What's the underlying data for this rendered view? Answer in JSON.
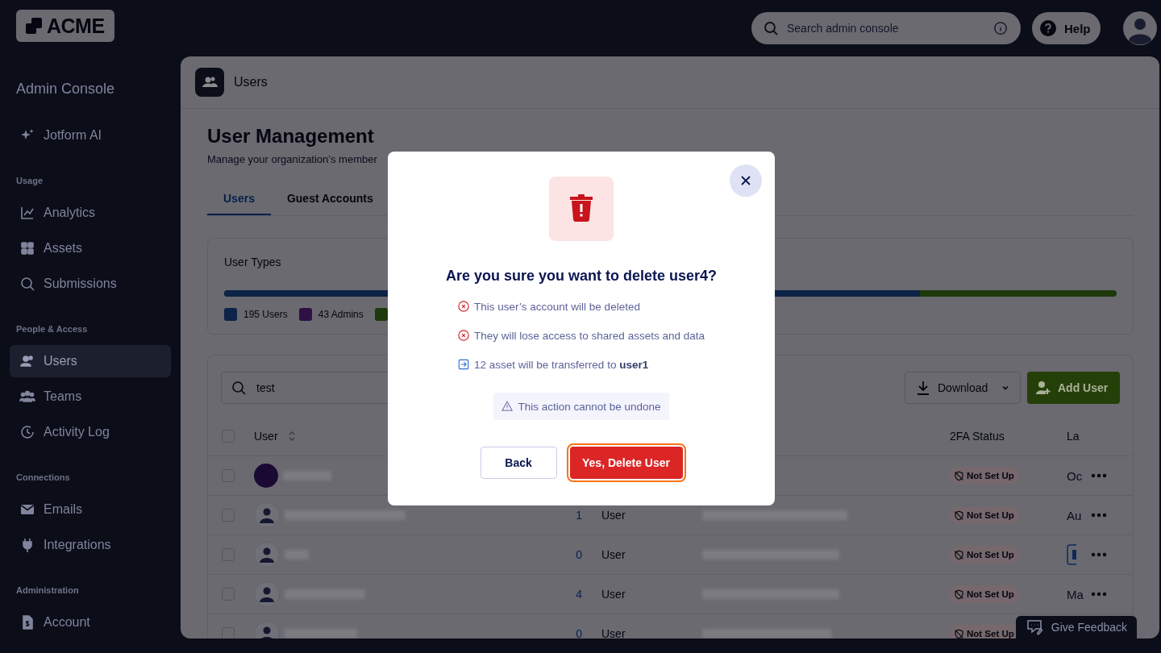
{
  "logo": {
    "text": "ACME"
  },
  "topbar": {
    "search": {
      "placeholder": "Search admin console"
    },
    "help": "Help"
  },
  "sidebar": {
    "title": "Admin Console",
    "sections": [
      {
        "items": [
          {
            "label": "Jotform AI",
            "selected": false
          }
        ]
      },
      {
        "heading": "Usage",
        "items": [
          {
            "label": "Analytics",
            "selected": false
          },
          {
            "label": "Assets",
            "selected": false
          },
          {
            "label": "Submissions",
            "selected": false
          }
        ]
      },
      {
        "heading": "People & Access",
        "items": [
          {
            "label": "Users",
            "selected": true
          },
          {
            "label": "Teams",
            "selected": false
          },
          {
            "label": "Activity Log",
            "selected": false
          }
        ]
      },
      {
        "heading": "Connections",
        "items": [
          {
            "label": "Emails",
            "selected": false
          },
          {
            "label": "Integrations",
            "selected": false
          }
        ]
      },
      {
        "heading": "Administration",
        "items": [
          {
            "label": "Account",
            "selected": false
          }
        ]
      }
    ]
  },
  "page": {
    "header": "Users",
    "title": "User Management",
    "subtitle": "Manage your organization’s member",
    "tabs": [
      {
        "label": "Users",
        "selected": true
      },
      {
        "label": "Guest Accounts",
        "selected": false
      }
    ],
    "user_types": {
      "title": "User Types",
      "level": 0.78,
      "legend": [
        {
          "label": "195 Users",
          "color": "#0d2347"
        },
        {
          "label": "43 Admins",
          "color": "#2e1044"
        },
        {
          "color": "#1e3a0c"
        }
      ]
    },
    "table": {
      "search": {
        "value": "test"
      },
      "download": "Download",
      "add_user": "Add User",
      "select_all": {
        "checked": false
      },
      "columns": {
        "user": "User",
        "twofa": "2FA Status",
        "last": "La"
      },
      "rows": [
        {
          "checked": false,
          "photo": true,
          "twofa": "Not Set Up",
          "last": "Oc"
        },
        {
          "checked": false,
          "photo": false,
          "count": "1",
          "role": "User",
          "twofa": "Not Set Up",
          "last": "Au"
        },
        {
          "checked": false,
          "photo": false,
          "count": "0",
          "role": "User",
          "twofa": "Not Set Up"
        },
        {
          "checked": false,
          "photo": false,
          "count": "4",
          "role": "User",
          "twofa": "Not Set Up",
          "last": "Ma"
        },
        {
          "checked": false,
          "photo": false,
          "count": "0",
          "role": "User",
          "twofa": "Not Set Up"
        }
      ]
    }
  },
  "feedback": "Give Feedback",
  "modal": {
    "title": "Are you sure you want to delete user4?",
    "items": [
      {
        "kind": "removed",
        "text": "This user’s account will be deleted"
      },
      {
        "kind": "removed",
        "text": "They will lose access to shared assets and data"
      },
      {
        "kind": "transfer",
        "text": "12 asset will be transferred to **user1**"
      }
    ],
    "warning": "This action cannot be undone",
    "buttons": [
      {
        "label": "Back",
        "kind": "secondary",
        "focused": false
      },
      {
        "label": "Yes, Delete User",
        "kind": "danger",
        "focused": true
      }
    ]
  }
}
